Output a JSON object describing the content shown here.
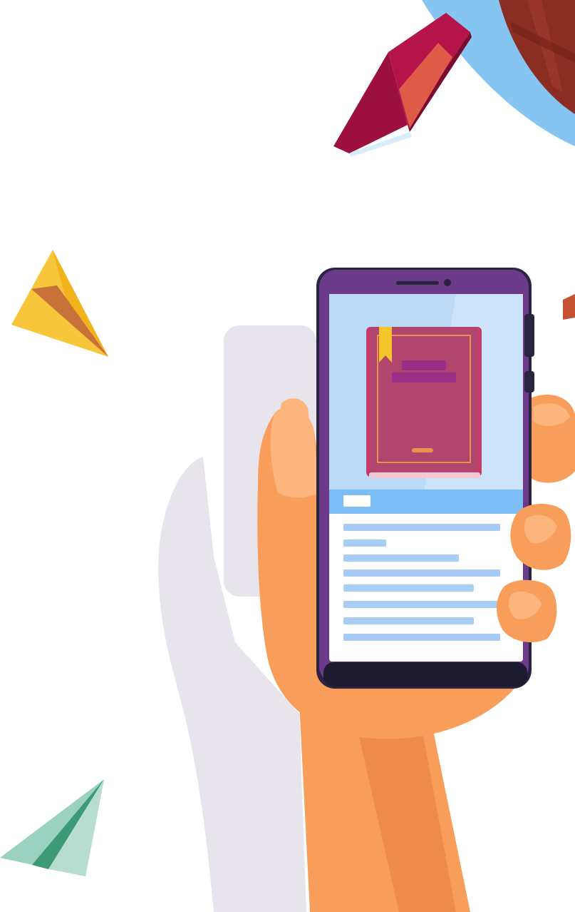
{
  "illustration": {
    "subject": "hand-holding-smartphone-with-ebook",
    "colors": {
      "background": "#ffffff",
      "shadow": "#e8e4ec",
      "skin": "#f99d5b",
      "skin_dark": "#e57c3e",
      "skin_light": "#fbb57d",
      "phone_frame": "#6b3a8a",
      "phone_body": "#2b2440",
      "screen_top": "#bcd9f5",
      "screen_panel": "#ffffff",
      "screen_bar": "#7dbdf5",
      "text_lines": "#a9ccf4",
      "book_cover": "#b2456e",
      "book_spine": "#c43c6a",
      "book_trim": "#e7934b",
      "bookmark": "#f5c52e",
      "globe_ring": "#86c4f2",
      "globe": "#8b2d22",
      "flying_book": "#b5144a",
      "flying_book_trim": "#e05a48",
      "plane_yellow": "#f7c63a",
      "plane_yellow_fold": "#c8723a",
      "plane_green": "#9ad1c0",
      "plane_green_dark": "#3d9a76"
    }
  }
}
